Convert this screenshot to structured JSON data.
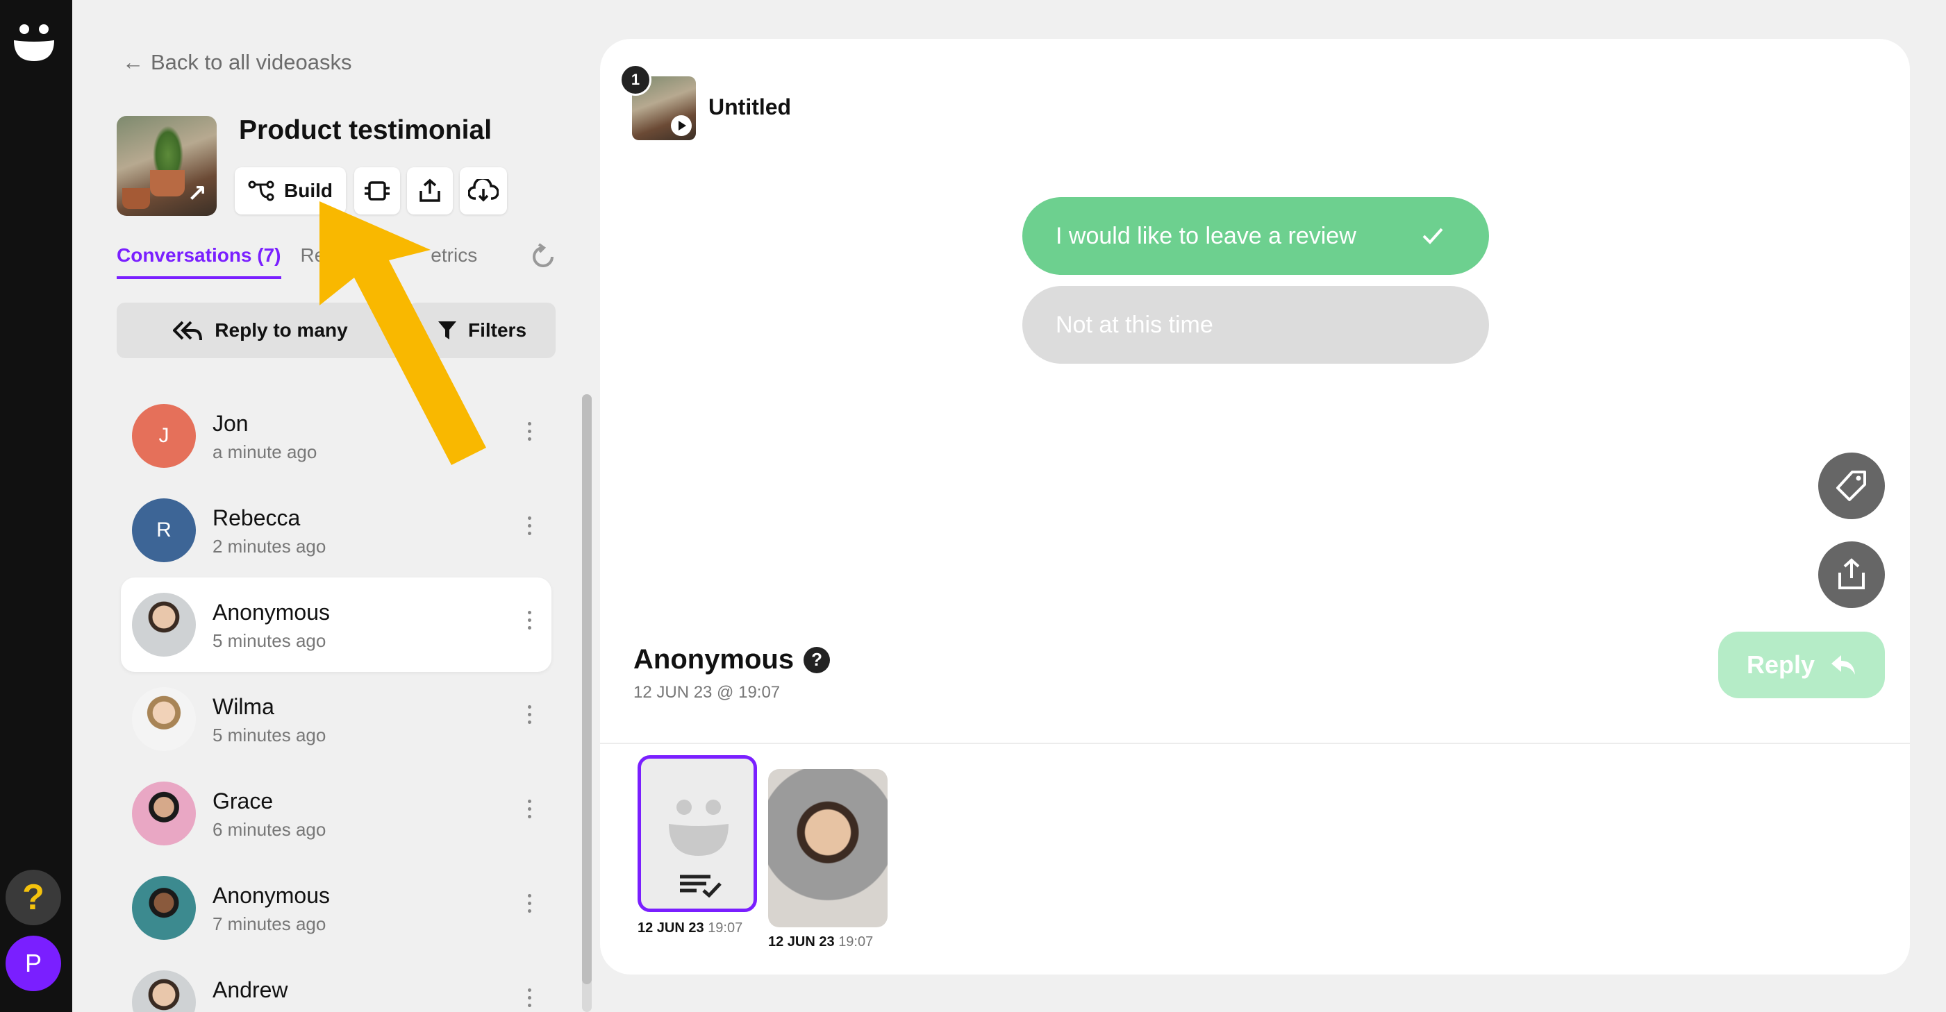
{
  "sidebar": {
    "back_label": "Back to all videoasks",
    "form_title": "Product testimonial",
    "build_label": "Build",
    "tabs": {
      "conversations": "Conversations (7)",
      "results_fragment": "Res",
      "metrics_fragment": "etrics"
    },
    "reply_to_many_label": "Reply to many",
    "filters_label": "Filters",
    "conversations": [
      {
        "name": "Jon",
        "time": "a minute ago",
        "initial": "J",
        "color": "#e5705a"
      },
      {
        "name": "Rebecca",
        "time": "2 minutes ago",
        "initial": "R",
        "color": "#3d6596"
      },
      {
        "name": "Anonymous",
        "time": "5 minutes ago",
        "initial": "",
        "color": ""
      },
      {
        "name": "Wilma",
        "time": "5 minutes ago",
        "initial": "",
        "color": ""
      },
      {
        "name": "Grace",
        "time": "6 minutes ago",
        "initial": "",
        "color": ""
      },
      {
        "name": "Anonymous",
        "time": "7 minutes ago",
        "initial": "",
        "color": ""
      },
      {
        "name": "Andrew",
        "time": "",
        "initial": "",
        "color": ""
      }
    ]
  },
  "rail": {
    "help_label": "?",
    "profile_initial": "P"
  },
  "main": {
    "step_number": "1",
    "step_title": "Untitled",
    "choices": [
      {
        "label": "I would like to leave a review",
        "selected": true
      },
      {
        "label": "Not at this time",
        "selected": false
      }
    ],
    "responder_name": "Anonymous",
    "responder_date": "12 JUN 23 @ 19:07",
    "reply_label": "Reply",
    "attachments": [
      {
        "date": "12 JUN 23",
        "time": "19:07"
      },
      {
        "date": "12 JUN 23",
        "time": "19:07"
      }
    ]
  },
  "colors": {
    "accent": "#7a1fff",
    "success": "#6dd08f",
    "annotation": "#f9b800"
  }
}
